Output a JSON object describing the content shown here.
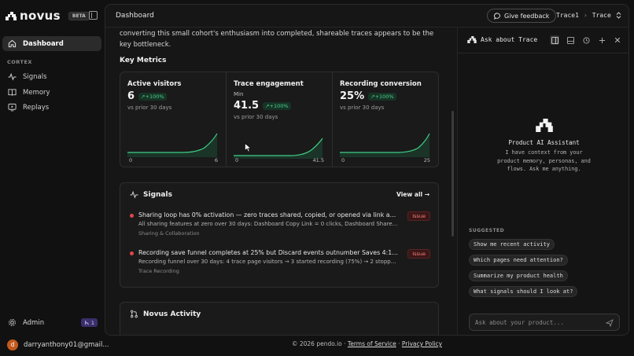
{
  "app": {
    "logo": "novus",
    "beta": "BETA"
  },
  "sidebar": {
    "items": [
      {
        "label": "Dashboard",
        "icon": "home-icon",
        "active": true
      }
    ],
    "section": "CORTEX",
    "cortex_items": [
      {
        "label": "Signals",
        "icon": "pulse-icon"
      },
      {
        "label": "Memory",
        "icon": "book-icon"
      },
      {
        "label": "Replays",
        "icon": "replay-icon"
      }
    ],
    "admin": {
      "label": "Admin",
      "badge": "1"
    },
    "user": {
      "initial": "d",
      "email": "darryanthony01@gmail..."
    }
  },
  "topbar": {
    "title": "Dashboard",
    "feedback": "Give feedback",
    "crumb_1": "Trace1",
    "crumb_2": "Trace"
  },
  "main": {
    "intro": "converting this small cohort's enthusiasm into completed, shareable traces appears to be the key bottleneck.",
    "key_metrics": "Key Metrics",
    "metrics": [
      {
        "title": "Active visitors",
        "sub": "",
        "value": "6",
        "delta": "+100%",
        "compare": "vs prior 30 days",
        "axis_min": "0",
        "axis_max": "6"
      },
      {
        "title": "Trace engagement",
        "sub": "Min",
        "value": "41.5",
        "delta": "+100%",
        "compare": "vs prior 30 days",
        "axis_min": "0",
        "axis_max": "41.5"
      },
      {
        "title": "Recording conversion",
        "sub": "",
        "value": "25%",
        "delta": "+100%",
        "compare": "vs prior 30 days",
        "axis_min": "0",
        "axis_max": "25"
      }
    ],
    "signals": {
      "title": "Signals",
      "view_all": "View all →",
      "items": [
        {
          "title": "Sharing loop has 0% activation — zero traces shared, copied, or opened via link across all 5...",
          "desc": "All sharing features at zero over 30 days: Dashboard Copy Link = 0 clicks, Dashboard Share Trace = 0...",
          "tag": "Sharing & Collaboration",
          "badge": "Issue"
        },
        {
          "title": "Recording save funnel completes at 25% but Discard events outnumber Saves 4:1, with...",
          "desc": "Recording funnel over 30 days: 4 trace page visitors → 3 started recording (75%) → 2 stopped (50%) ...",
          "tag": "Trace Recording",
          "badge": "Issue"
        }
      ]
    },
    "activity": {
      "title": "Novus Activity"
    }
  },
  "ai": {
    "title": "Ask about Trace",
    "assistant_title": "Product AI Assistant",
    "assistant_desc": "I have context from your product memory, personas, and flows. Ask me anything.",
    "suggested": "SUGGESTED",
    "chips": [
      "Show me recent activity",
      "Which pages need attention?",
      "Summarize my product health",
      "What signals should I look at?"
    ],
    "placeholder": "Ask about your product..."
  },
  "footer": {
    "copyright": "© 2026 pendo.io ·",
    "terms": "Terms of Service",
    "sep": "·",
    "privacy": "Privacy Policy"
  },
  "colors": {
    "accent_green": "#4ad18a",
    "issue_red": "#e04848",
    "admin_badge": "#3a2f6b"
  }
}
